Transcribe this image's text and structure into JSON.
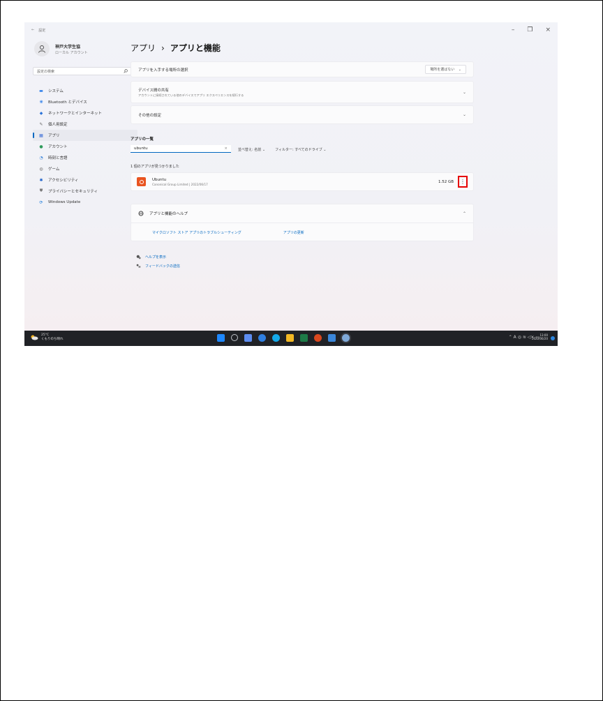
{
  "window": {
    "controls": [
      "–",
      "❐",
      "×"
    ]
  },
  "nav_header": {
    "back": "←",
    "title": "設定"
  },
  "user": {
    "name": "神戸大学生協",
    "account": "ローカル アカウント"
  },
  "search": {
    "placeholder": "設定の検索",
    "icon": "search-icon"
  },
  "sidebar": {
    "items": [
      {
        "label": "システム",
        "icon": "▬",
        "color": "#1a73e8"
      },
      {
        "label": "Bluetooth とデバイス",
        "icon": "❋",
        "color": "#1a73e8"
      },
      {
        "label": "ネットワークとインターネット",
        "icon": "◆",
        "color": "#2a73d9"
      },
      {
        "label": "個人用設定",
        "icon": "✎",
        "color": "#666666"
      },
      {
        "label": "アプリ",
        "icon": "▦",
        "color": "#3c6fd6",
        "active": true
      },
      {
        "label": "アカウント",
        "icon": "●",
        "color": "#2e9a5a"
      },
      {
        "label": "時刻と言語",
        "icon": "◔",
        "color": "#2a7bd6"
      },
      {
        "label": "ゲーム",
        "icon": "◍",
        "color": "#7a7a7a"
      },
      {
        "label": "アクセシビリティ",
        "icon": "✱",
        "color": "#1a5fc8"
      },
      {
        "label": "プライバシーとセキュリティ",
        "icon": "⛊",
        "color": "#7b7b7b"
      },
      {
        "label": "Windows Update",
        "icon": "⟳",
        "color": "#0a72d9"
      }
    ]
  },
  "header": {
    "parent": "アプリ",
    "separator": "›",
    "current": "アプリと機能"
  },
  "settings": {
    "install_source": {
      "label": "アプリを入手する場所の選択",
      "value": "場所を選ばない",
      "chevron": "⌄"
    },
    "share": {
      "label": "デバイス間の共有",
      "sub": "アカウントに接続されている他のデバイスでアプリ エクスペリエンスを続行する",
      "chevron": "⌄"
    },
    "more": {
      "label": "その他の設定",
      "chevron": "⌄"
    }
  },
  "app_list": {
    "title": "アプリの一覧",
    "filter_value": "ubuntu",
    "clear": "×",
    "sort_label": "並べ替え: 名前 ⌄",
    "filter_label": "フィルター: すべてのドライブ ⌄",
    "found_text": "1 個のアプリが見つかりました",
    "items": [
      {
        "name": "Ubuntu",
        "publisher": "Canonical Group Limited | 2022/06/17",
        "size": "1.52 GB",
        "more": "⋮"
      }
    ]
  },
  "help": {
    "title": "アプリと機能のヘルプ",
    "chevron": "⌃",
    "links": [
      "マイクロソフト ストア アプリのトラブルシューティング",
      "アプリの更新"
    ]
  },
  "footer": {
    "get_help": "ヘルプを表示",
    "feedback": "フィードバックの送信"
  },
  "taskbar": {
    "weather_temp": "25°C",
    "weather_desc": "くもりのち晴れ",
    "apps": [
      "#1e88ff",
      "#bfc3c9",
      "#5d8df0",
      "#2f7fe0",
      "#13a8e8",
      "#f2b824",
      "#1d7a47",
      "#d9481e",
      "#3a86d9",
      "#7fa9d8"
    ],
    "tray": "⌃  A  ◎  ≋  ◁×  ▭",
    "time": "13:00",
    "date": "2022/06/20"
  }
}
